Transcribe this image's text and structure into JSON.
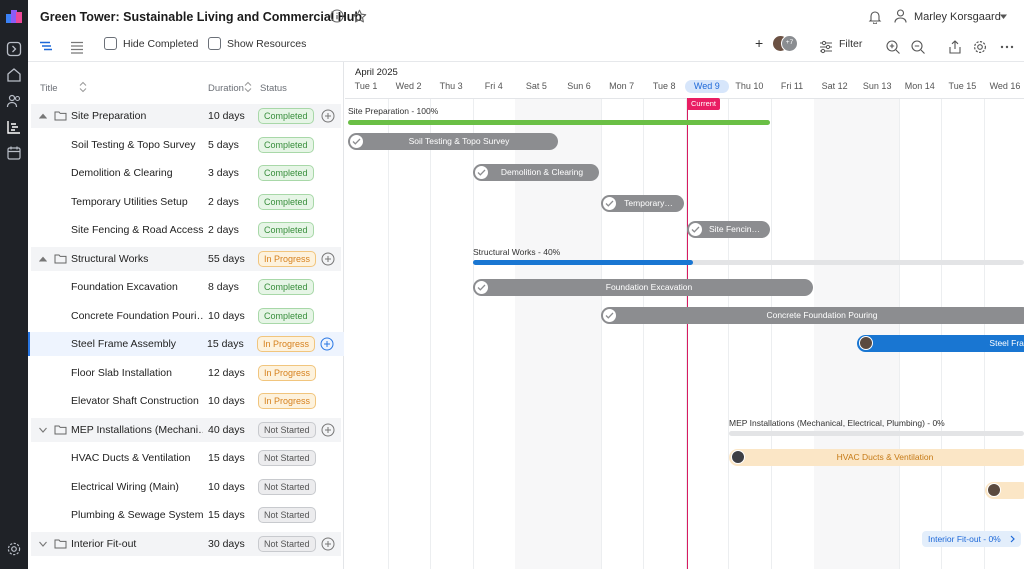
{
  "app": {
    "title": "Green Tower: Sustainable Living and Commercial Hub",
    "user_name": "Marley Korsgaard"
  },
  "toolbar": {
    "hide_completed_label": "Hide Completed",
    "show_resources_label": "Show Resources",
    "filter_label": "Filter",
    "team_count": "+7"
  },
  "columns": {
    "title": "Title",
    "duration": "Duration",
    "status": "Status"
  },
  "rows": [
    {
      "title": "Site Preparation",
      "duration": "10 days",
      "status": "Completed",
      "group": true
    },
    {
      "title": "Soil Testing & Topo Survey",
      "duration": "5 days",
      "status": "Completed"
    },
    {
      "title": "Demolition & Clearing",
      "duration": "3 days",
      "status": "Completed"
    },
    {
      "title": "Temporary Utilities Setup",
      "duration": "2 days",
      "status": "Completed"
    },
    {
      "title": "Site Fencing & Road Access",
      "duration": "2 days",
      "status": "Completed"
    },
    {
      "title": "Structural Works",
      "duration": "55 days",
      "status": "In Progress",
      "group": true
    },
    {
      "title": "Foundation Excavation",
      "duration": "8 days",
      "status": "Completed"
    },
    {
      "title": "Concrete Foundation Pouri…",
      "duration": "10 days",
      "status": "Completed"
    },
    {
      "title": "Steel Frame Assembly",
      "duration": "15 days",
      "status": "In Progress",
      "selected": true
    },
    {
      "title": "Floor Slab Installation",
      "duration": "12 days",
      "status": "In Progress"
    },
    {
      "title": "Elevator Shaft Construction",
      "duration": "10 days",
      "status": "In Progress"
    },
    {
      "title": "MEP Installations (Mechani…",
      "duration": "40 days",
      "status": "Not Started",
      "group": true
    },
    {
      "title": "HVAC Ducts & Ventilation",
      "duration": "15 days",
      "status": "Not Started"
    },
    {
      "title": "Electrical Wiring (Main)",
      "duration": "10 days",
      "status": "Not Started"
    },
    {
      "title": "Plumbing & Sewage Systems",
      "duration": "15 days",
      "status": "Not Started"
    },
    {
      "title": "Interior Fit-out",
      "duration": "30 days",
      "status": "Not Started",
      "group": true
    }
  ],
  "timeline": {
    "month": "April 2025",
    "days": [
      "Tue 1",
      "Wed 2",
      "Thu 3",
      "Fri 4",
      "Sat 5",
      "Sun 6",
      "Mon 7",
      "Tue 8",
      "Wed 9",
      "Thu 10",
      "Fri 11",
      "Sat 12",
      "Sun 13",
      "Mon 14",
      "Tue 15",
      "Wed 16"
    ],
    "today_label": "Current"
  },
  "gantt": {
    "site_prep_label": "Site Preparation - 100%",
    "site_prep_progress": 1.0,
    "structural_label": "Structural Works - 40%",
    "structural_progress": 0.4,
    "mep_label": "MEP Installations (Mechanical, Electrical, Plumbing) - 0%",
    "mep_progress": 0,
    "bars": {
      "soil": "Soil Testing & Topo Survey",
      "demolition": "Demolition & Clearing",
      "temporary": "Temporary…",
      "fencing": "Site Fencin…",
      "foundation": "Foundation Excavation",
      "concrete": "Concrete Foundation Pouring",
      "steel": "Steel Fram",
      "hvac": "HVAC Ducts & Ventilation"
    },
    "interior_pill": "Interior Fit-out - 0%"
  },
  "colors": {
    "completed_green": "#6abf45",
    "progress_blue": "#1976d2",
    "today_red": "#e91e63",
    "done_bar": "#8c8d90",
    "pending_bar": "#fbe6c6"
  }
}
